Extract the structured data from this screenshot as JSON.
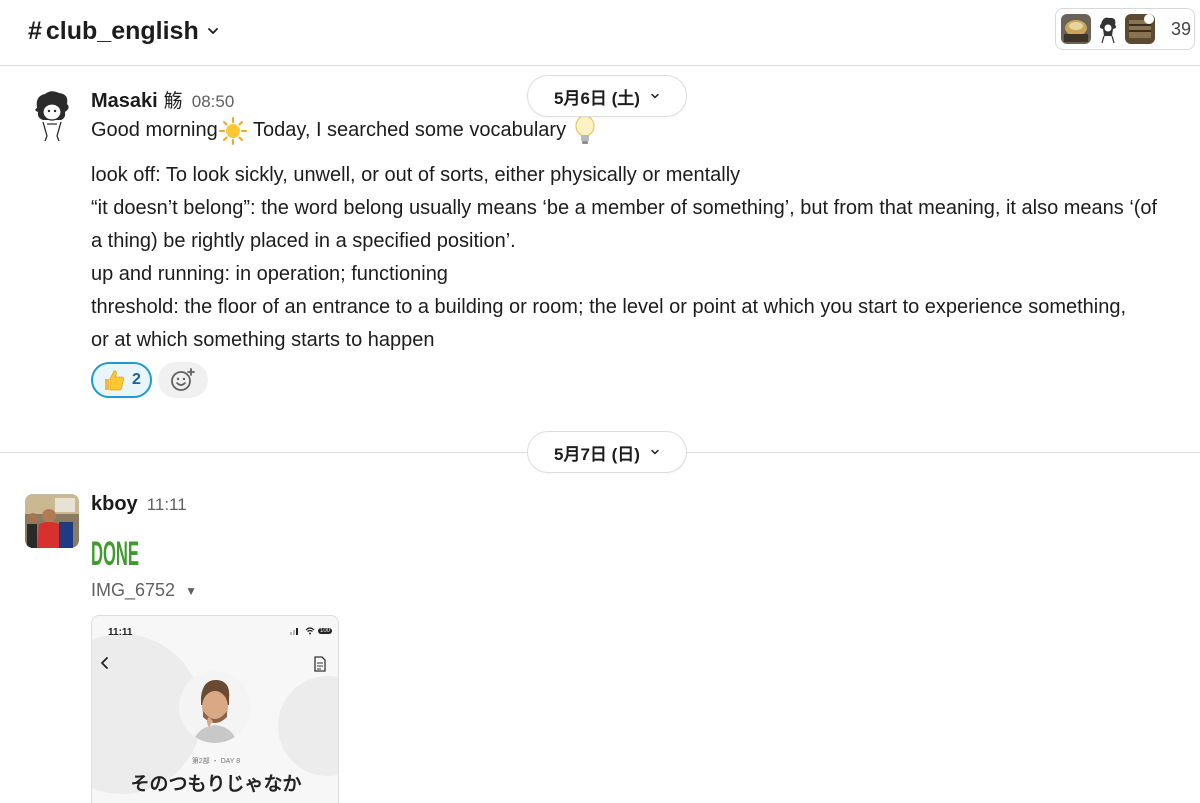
{
  "header": {
    "channel_name": "club_english",
    "hash_symbol": "#",
    "member_count": "39"
  },
  "dates": [
    {
      "label": "5月6日 (土)"
    },
    {
      "label": "5月7日 (日)"
    }
  ],
  "messages": [
    {
      "author": "Masaki",
      "author_suffix": "觞",
      "time": "08:50",
      "greeting_part1": "Good morning",
      "greeting_part2": " Today, I searched some vocabulary",
      "lines": [
        "look off: To look sickly, unwell, or out of sorts, either physically or mentally",
        "“it doesn’t belong”: the word belong usually means ‘be a member of something’, but from that meaning, it also means ‘(of",
        "a thing) be rightly placed in a specified position’.",
        "up and running: in operation; functioning",
        "threshold: the floor of an entrance to a building or room; the level or point at which you start to experience something,",
        "or at which something starts to happen"
      ],
      "reactions": [
        {
          "emoji": "thumbs-up",
          "count": "2"
        }
      ]
    },
    {
      "author": "kboy",
      "time": "11:11",
      "emoji": "DONE",
      "file_name": "IMG_6752",
      "attachment": {
        "status_time": "11:11",
        "battery": "100",
        "lesson_label": "第2部 ・ DAY 8",
        "lesson_title": "そのつもりじゃなか"
      }
    }
  ],
  "colors": {
    "reaction_border": "#1d9bd1",
    "reaction_bg": "#e8f5fa",
    "done_green": "#3f9b2f"
  }
}
